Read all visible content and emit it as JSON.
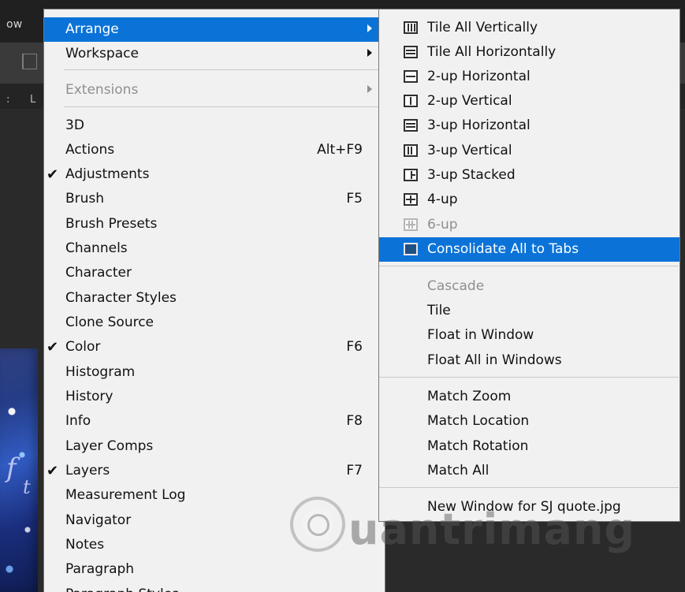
{
  "app": {
    "top_label": "ow",
    "left_tool_text_1": ":",
    "left_tool_text_2": "L"
  },
  "canvas": {
    "overlay_letters": [
      "f",
      "t"
    ]
  },
  "watermark": {
    "text": "uantrimang"
  },
  "main_menu": {
    "items": [
      {
        "label": "Arrange",
        "shortcut": "",
        "checked": false,
        "disabled": false,
        "highlight": true,
        "submenu": true
      },
      {
        "label": "Workspace",
        "shortcut": "",
        "checked": false,
        "disabled": false,
        "highlight": false,
        "submenu": true
      },
      {
        "label": "Extensions",
        "shortcut": "",
        "checked": false,
        "disabled": true,
        "highlight": false,
        "submenu": true
      },
      {
        "label": "3D",
        "shortcut": "",
        "checked": false,
        "disabled": false,
        "highlight": false,
        "submenu": false
      },
      {
        "label": "Actions",
        "shortcut": "Alt+F9",
        "checked": false,
        "disabled": false,
        "highlight": false,
        "submenu": false
      },
      {
        "label": "Adjustments",
        "shortcut": "",
        "checked": true,
        "disabled": false,
        "highlight": false,
        "submenu": false
      },
      {
        "label": "Brush",
        "shortcut": "F5",
        "checked": false,
        "disabled": false,
        "highlight": false,
        "submenu": false
      },
      {
        "label": "Brush Presets",
        "shortcut": "",
        "checked": false,
        "disabled": false,
        "highlight": false,
        "submenu": false
      },
      {
        "label": "Channels",
        "shortcut": "",
        "checked": false,
        "disabled": false,
        "highlight": false,
        "submenu": false
      },
      {
        "label": "Character",
        "shortcut": "",
        "checked": false,
        "disabled": false,
        "highlight": false,
        "submenu": false
      },
      {
        "label": "Character Styles",
        "shortcut": "",
        "checked": false,
        "disabled": false,
        "highlight": false,
        "submenu": false
      },
      {
        "label": "Clone Source",
        "shortcut": "",
        "checked": false,
        "disabled": false,
        "highlight": false,
        "submenu": false
      },
      {
        "label": "Color",
        "shortcut": "F6",
        "checked": true,
        "disabled": false,
        "highlight": false,
        "submenu": false
      },
      {
        "label": "Histogram",
        "shortcut": "",
        "checked": false,
        "disabled": false,
        "highlight": false,
        "submenu": false
      },
      {
        "label": "History",
        "shortcut": "",
        "checked": false,
        "disabled": false,
        "highlight": false,
        "submenu": false
      },
      {
        "label": "Info",
        "shortcut": "F8",
        "checked": false,
        "disabled": false,
        "highlight": false,
        "submenu": false
      },
      {
        "label": "Layer Comps",
        "shortcut": "",
        "checked": false,
        "disabled": false,
        "highlight": false,
        "submenu": false
      },
      {
        "label": "Layers",
        "shortcut": "F7",
        "checked": true,
        "disabled": false,
        "highlight": false,
        "submenu": false
      },
      {
        "label": "Measurement Log",
        "shortcut": "",
        "checked": false,
        "disabled": false,
        "highlight": false,
        "submenu": false
      },
      {
        "label": "Navigator",
        "shortcut": "",
        "checked": false,
        "disabled": false,
        "highlight": false,
        "submenu": false
      },
      {
        "label": "Notes",
        "shortcut": "",
        "checked": false,
        "disabled": false,
        "highlight": false,
        "submenu": false
      },
      {
        "label": "Paragraph",
        "shortcut": "",
        "checked": false,
        "disabled": false,
        "highlight": false,
        "submenu": false
      },
      {
        "label": "Paragraph Styles",
        "shortcut": "",
        "checked": false,
        "disabled": false,
        "highlight": false,
        "submenu": false
      }
    ]
  },
  "arrange_menu": {
    "items": [
      {
        "label": "Tile All Vertically",
        "disabled": false,
        "highlight": false,
        "icon": "tile-vertically-icon",
        "style": "tile-vert"
      },
      {
        "label": "Tile All Horizontally",
        "disabled": false,
        "highlight": false,
        "icon": "tile-horizontally-icon",
        "style": "tile-horiz"
      },
      {
        "label": "2-up Horizontal",
        "disabled": false,
        "highlight": false,
        "icon": "two-up-horizontal-icon",
        "style": "two-horiz"
      },
      {
        "label": "2-up Vertical",
        "disabled": false,
        "highlight": false,
        "icon": "two-up-vertical-icon",
        "style": "two-vert"
      },
      {
        "label": "3-up Horizontal",
        "disabled": false,
        "highlight": false,
        "icon": "three-up-horizontal-icon",
        "style": "three-horiz"
      },
      {
        "label": "3-up Vertical",
        "disabled": false,
        "highlight": false,
        "icon": "three-up-vertical-icon",
        "style": "three-vert"
      },
      {
        "label": "3-up Stacked",
        "disabled": false,
        "highlight": false,
        "icon": "three-up-stacked-icon",
        "style": "three-stacked"
      },
      {
        "label": "4-up",
        "disabled": false,
        "highlight": false,
        "icon": "four-up-icon",
        "style": "four-up"
      },
      {
        "label": "6-up",
        "disabled": true,
        "highlight": false,
        "icon": "six-up-icon",
        "style": "six-up"
      },
      {
        "label": "Consolidate All to Tabs",
        "disabled": false,
        "highlight": true,
        "icon": "consolidate-tabs-icon",
        "style": "consolidate"
      },
      {
        "label": "Cascade",
        "disabled": true,
        "highlight": false,
        "icon": "",
        "style": ""
      },
      {
        "label": "Tile",
        "disabled": false,
        "highlight": false,
        "icon": "",
        "style": ""
      },
      {
        "label": "Float in Window",
        "disabled": false,
        "highlight": false,
        "icon": "",
        "style": ""
      },
      {
        "label": "Float All in Windows",
        "disabled": false,
        "highlight": false,
        "icon": "",
        "style": ""
      },
      {
        "label": "Match Zoom",
        "disabled": false,
        "highlight": false,
        "icon": "",
        "style": ""
      },
      {
        "label": "Match Location",
        "disabled": false,
        "highlight": false,
        "icon": "",
        "style": ""
      },
      {
        "label": "Match Rotation",
        "disabled": false,
        "highlight": false,
        "icon": "",
        "style": ""
      },
      {
        "label": "Match All",
        "disabled": false,
        "highlight": false,
        "icon": "",
        "style": ""
      },
      {
        "label": "New Window for SJ quote.jpg",
        "disabled": false,
        "highlight": false,
        "icon": "",
        "style": ""
      }
    ]
  },
  "colors": {
    "menu_bg": "#f1f1f1",
    "highlight": "#0b73d8",
    "disabled_text": "#8f8f8f"
  }
}
